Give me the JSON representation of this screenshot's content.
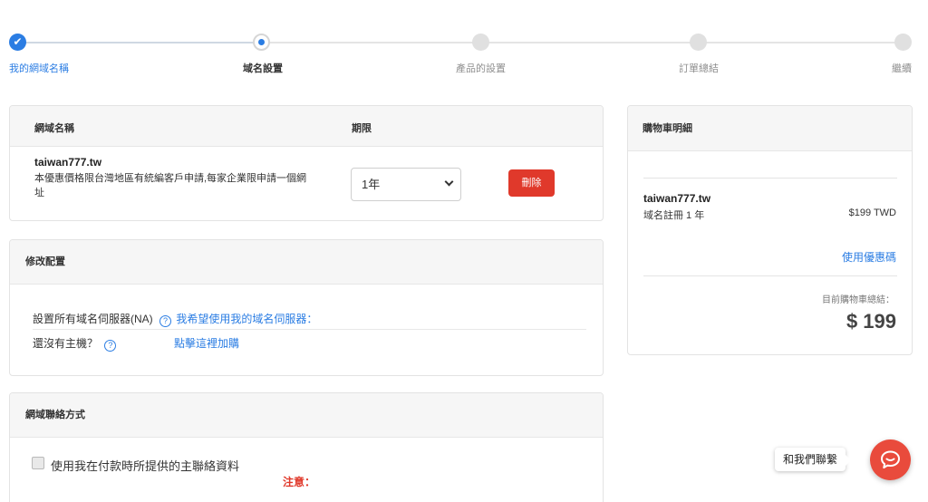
{
  "stepper": {
    "steps": [
      {
        "label": "我的網域名稱",
        "state": "done",
        "icon": "checkmark-icon"
      },
      {
        "label": "域名設置",
        "state": "active"
      },
      {
        "label": "產品的設置",
        "state": "pending"
      },
      {
        "label": "訂單總結",
        "state": "pending"
      },
      {
        "label": "繼續",
        "state": "pending"
      }
    ],
    "check_glyph": "✔"
  },
  "domain_table": {
    "col_domain": "網域名稱",
    "col_period": "期限",
    "domain": "taiwan777.tw",
    "note": "本優惠價格限台灣地區有統編客戶申請,每家企業限申請一個網址",
    "period_selected": "1年",
    "delete_label": "刪除"
  },
  "config": {
    "title": "修改配置",
    "nameserver_label": "設置所有域名伺服器(NA)",
    "nameserver_link": "我希望使用我的域名伺服器：",
    "hosting_label": "還沒有主機？",
    "hosting_link": "點擊這裡加購",
    "help_glyph": "?"
  },
  "contact": {
    "title": "網域聯絡方式",
    "checkbox_label": "使用我在付款時所提供的主聯絡資料",
    "notice": "注意："
  },
  "cart": {
    "title": "購物車明細",
    "item_name": "taiwan777.tw",
    "item_desc": "域名註冊 1 年",
    "item_price": "$199 TWD",
    "coupon_link": "使用優惠碼",
    "total_label": "目前購物車總結：",
    "total_amount": "$ 199"
  },
  "chat": {
    "tooltip": "和我們聯繫",
    "icon": "chat-bubble-icon"
  },
  "colors": {
    "accent": "#2b7de3",
    "danger": "#e0392b",
    "chat": "#e94b3c"
  }
}
